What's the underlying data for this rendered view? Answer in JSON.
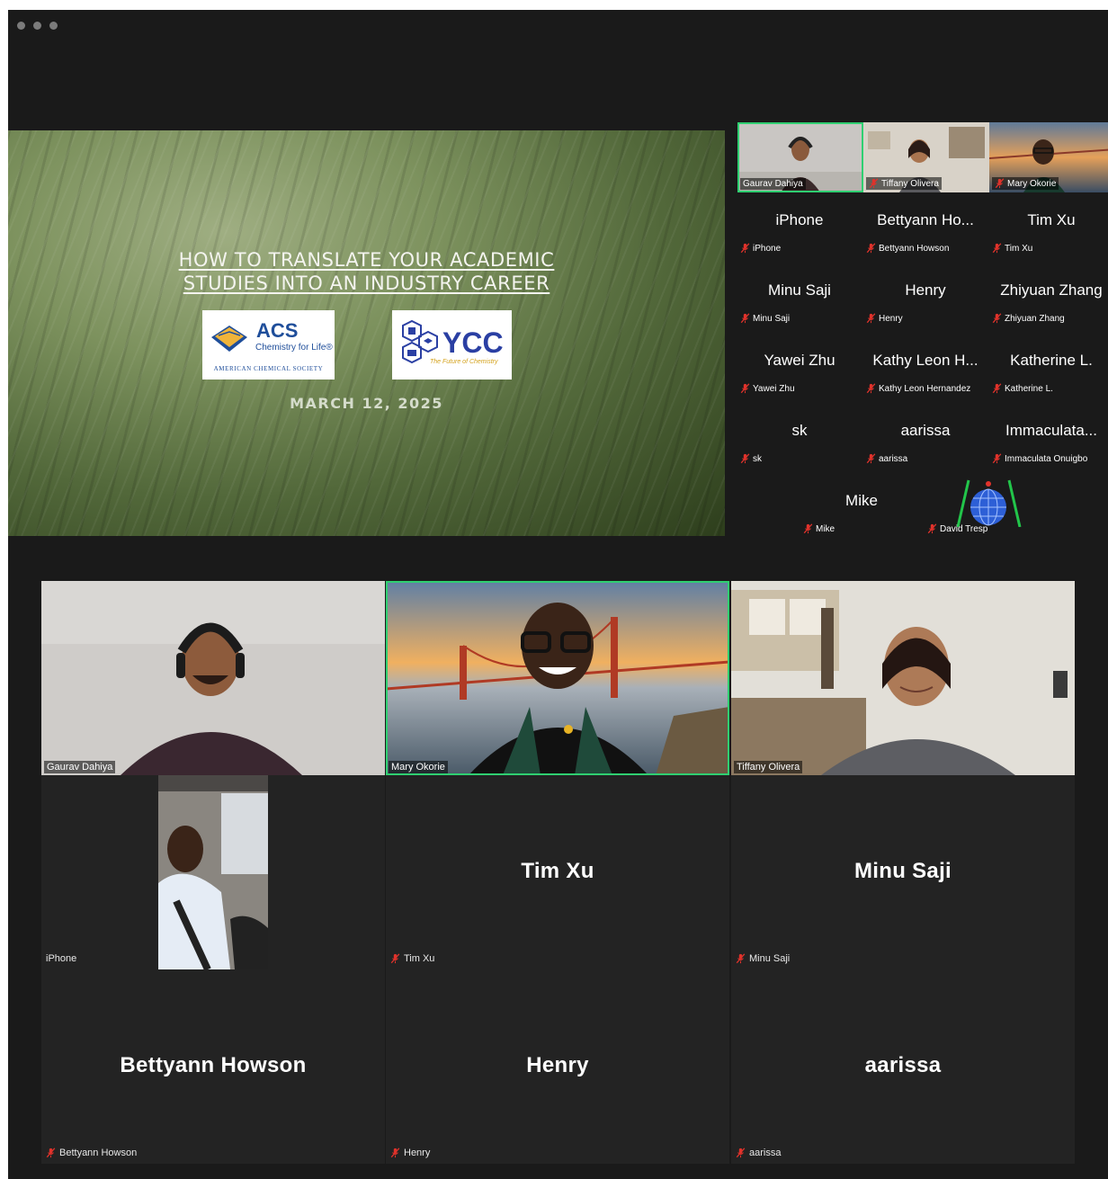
{
  "slide": {
    "title_line1": "HOW TO TRANSLATE YOUR ACADEMIC",
    "title_line2": "STUDIES INTO AN INDUSTRY CAREER",
    "acs_logo": {
      "abbr": "ACS",
      "tagline": "Chemistry for Life®",
      "org": "AMERICAN CHEMICAL SOCIETY"
    },
    "ycc_logo": {
      "abbr": "YCC",
      "tagline": "The Future of Chemistry"
    },
    "date": "MARCH 12, 2025"
  },
  "mini_panel": {
    "videos": [
      {
        "name": "Gaurav Dahiya",
        "muted": false,
        "active": true
      },
      {
        "name": "Tiffany Olivera",
        "muted": true,
        "active": false
      },
      {
        "name": "Mary Okorie",
        "muted": true,
        "active": false
      }
    ],
    "tiles": [
      {
        "display": "iPhone",
        "label": "iPhone"
      },
      {
        "display": "Bettyann Ho...",
        "label": "Bettyann Howson"
      },
      {
        "display": "Tim Xu",
        "label": "Tim Xu"
      },
      {
        "display": "Minu Saji",
        "label": "Minu Saji"
      },
      {
        "display": "Henry",
        "label": "Henry"
      },
      {
        "display": "Zhiyuan Zhang",
        "label": "Zhiyuan Zhang"
      },
      {
        "display": "Yawei Zhu",
        "label": "Yawei Zhu"
      },
      {
        "display": "Kathy Leon H...",
        "label": "Kathy Leon Hernandez"
      },
      {
        "display": "Katherine L.",
        "label": "Katherine L."
      },
      {
        "display": "sk",
        "label": "sk"
      },
      {
        "display": "aarissa",
        "label": "aarissa"
      },
      {
        "display": "Immaculata...",
        "label": "Immaculata Onuigbo"
      }
    ],
    "last_row": [
      {
        "display": "Mike",
        "label": "Mike"
      },
      {
        "display": "",
        "label": "David Tresp"
      }
    ]
  },
  "gallery": {
    "videos": [
      {
        "name": "Gaurav Dahiya",
        "active": false
      },
      {
        "name": "Mary Okorie",
        "active": true
      },
      {
        "name": "Tiffany Olivera",
        "active": false
      }
    ],
    "iphone": {
      "label": "iPhone"
    },
    "tiles": [
      {
        "display": "Tim Xu",
        "label": "Tim Xu"
      },
      {
        "display": "Minu Saji",
        "label": "Minu Saji"
      },
      {
        "display": "Bettyann Howson",
        "label": "Bettyann Howson"
      },
      {
        "display": "Henry",
        "label": "Henry"
      },
      {
        "display": "aarissa",
        "label": "aarissa"
      }
    ]
  },
  "colors": {
    "active_border": "#2fcf71",
    "muted_icon": "#e0322b",
    "tile_bg": "#232323"
  }
}
